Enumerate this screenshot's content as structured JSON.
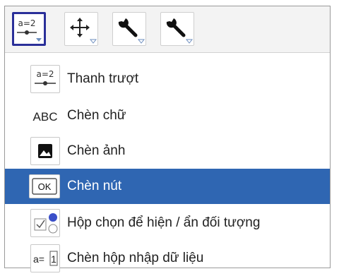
{
  "toolbar": {
    "tools": [
      {
        "icon": "slider-icon",
        "label": "a=2",
        "active": true
      },
      {
        "icon": "move-icon",
        "active": false
      },
      {
        "icon": "wrench-icon",
        "active": false
      },
      {
        "icon": "wrench-icon",
        "active": false
      }
    ]
  },
  "menu": {
    "items": [
      {
        "icon": "slider-icon",
        "icon_text": "a=2",
        "label": "Thanh trượt",
        "selected": false
      },
      {
        "icon": "text-icon",
        "icon_text": "ABC",
        "label": "Chèn chữ",
        "selected": false
      },
      {
        "icon": "image-icon",
        "label": "Chèn ảnh",
        "selected": false
      },
      {
        "icon": "button-icon",
        "icon_text": "OK",
        "label": "Chèn nút",
        "selected": true
      },
      {
        "icon": "checkbox-icon",
        "label": "Hộp chọn để hiện / ẩn đối tượng",
        "selected": false
      },
      {
        "icon": "input-box-icon",
        "icon_text_a": "a=",
        "icon_text_b": "1",
        "label": "Chèn hộp nhập dữ liệu",
        "selected": false
      }
    ]
  },
  "colors": {
    "selected_bg": "#2f66b2",
    "active_border": "#2a2f99",
    "triangle": "#6d8fbf"
  }
}
